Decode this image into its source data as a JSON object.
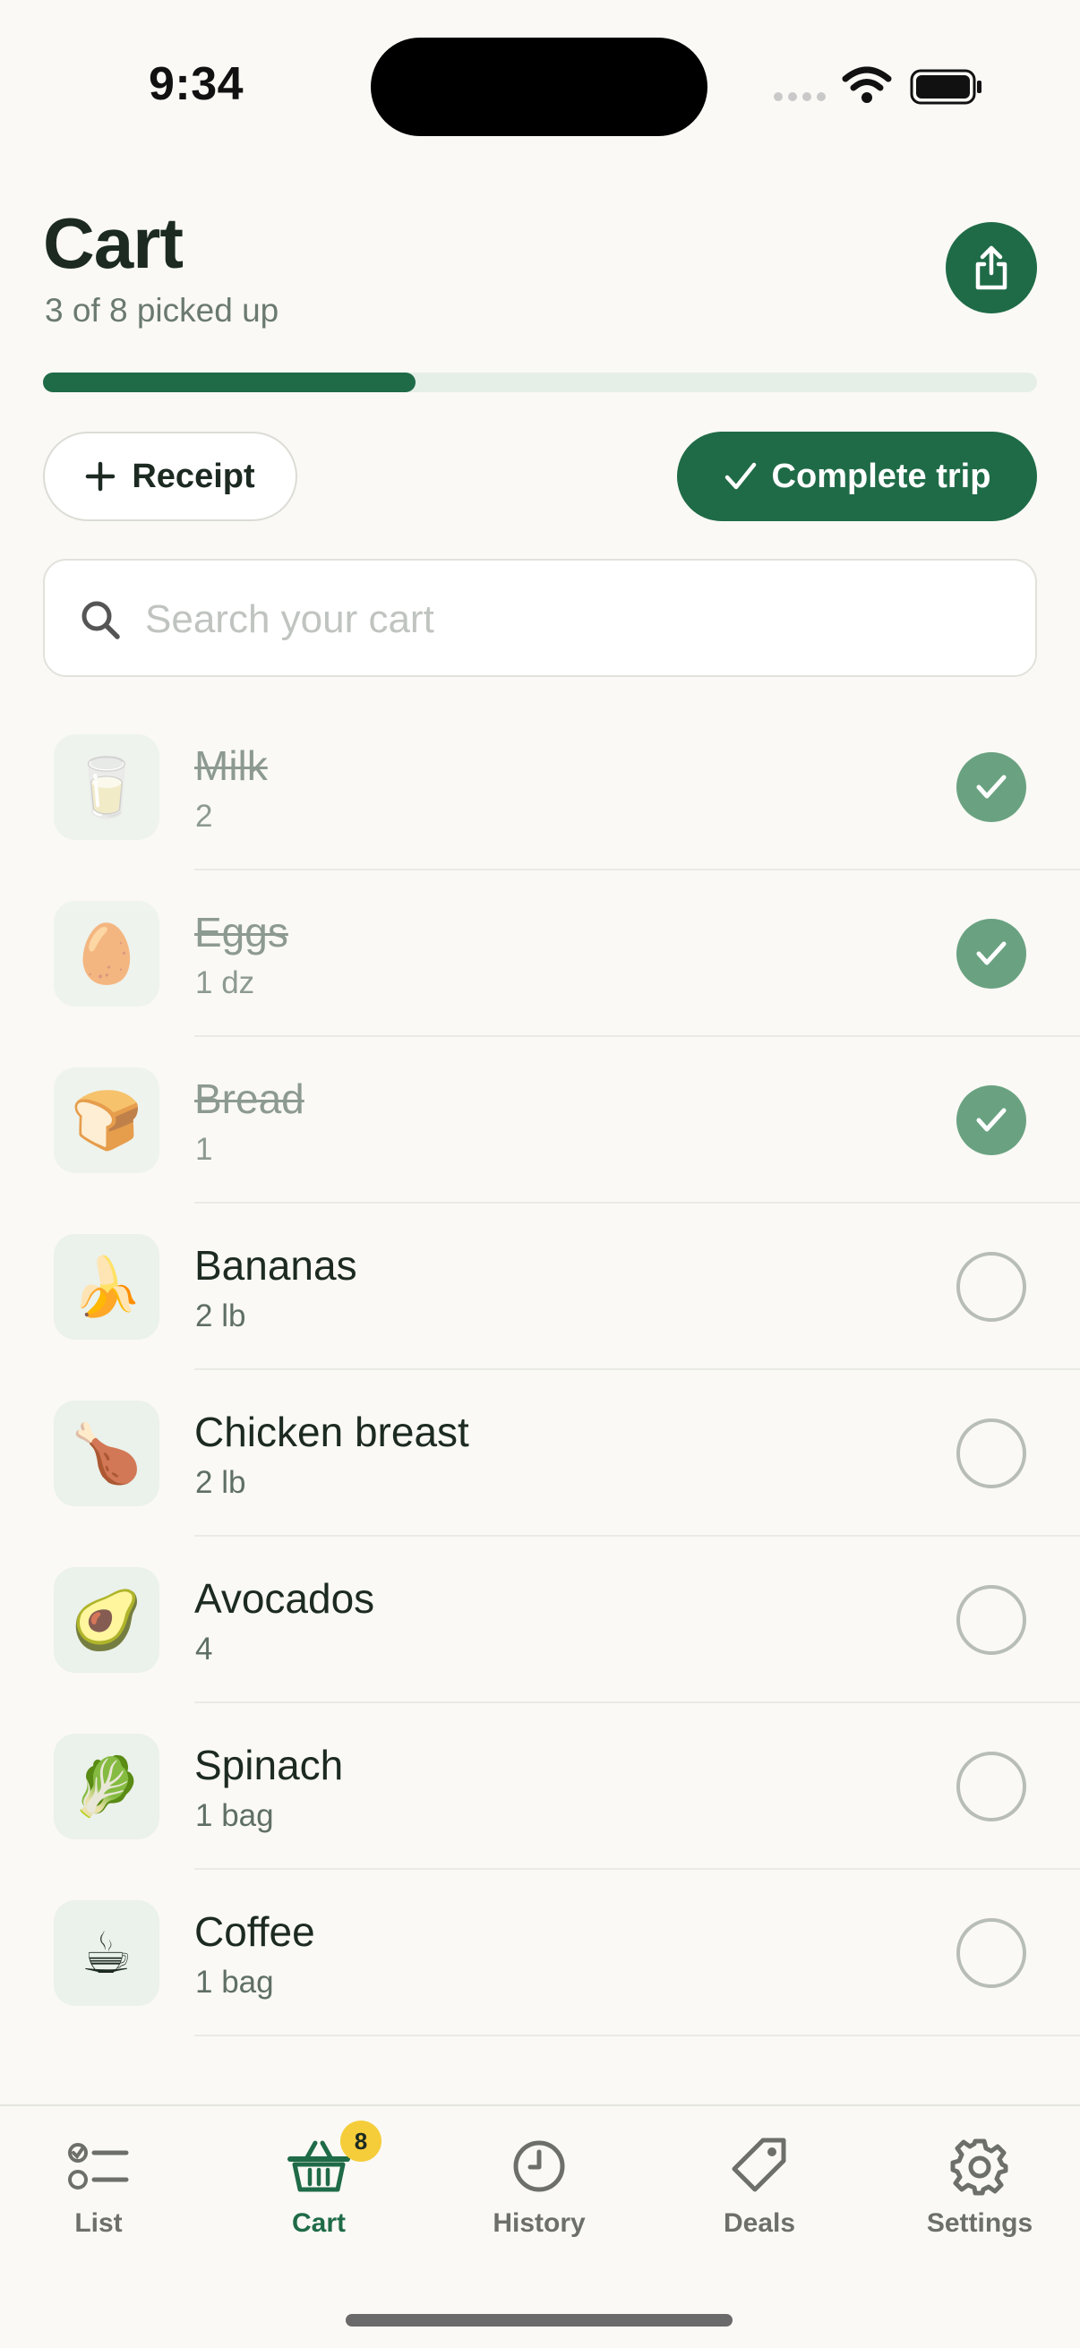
{
  "status": {
    "time": "9:34"
  },
  "header": {
    "title": "Cart",
    "subtitle": "3 of 8 picked up",
    "progress": 0.375
  },
  "actions": {
    "receipt_label": "Receipt",
    "complete_label": "Complete trip"
  },
  "search": {
    "placeholder": "Search your cart",
    "value": ""
  },
  "items": [
    {
      "emoji": "🥛",
      "name": "Milk",
      "qty": "2",
      "done": true
    },
    {
      "emoji": "🥚",
      "name": "Eggs",
      "qty": "1 dz",
      "done": true
    },
    {
      "emoji": "🍞",
      "name": "Bread",
      "qty": "1",
      "done": true
    },
    {
      "emoji": "🍌",
      "name": "Bananas",
      "qty": "2 lb",
      "done": false
    },
    {
      "emoji": "🍗",
      "name": "Chicken breast",
      "qty": "2 lb",
      "done": false
    },
    {
      "emoji": "🥑",
      "name": "Avocados",
      "qty": "4",
      "done": false
    },
    {
      "emoji": "🥬",
      "name": "Spinach",
      "qty": "1 bag",
      "done": false
    },
    {
      "emoji": "☕",
      "name": "Coffee",
      "qty": "1 bag",
      "done": false
    }
  ],
  "tabs": [
    {
      "label": "List",
      "icon": "checklist-icon",
      "active": false
    },
    {
      "label": "Cart",
      "icon": "basket-icon",
      "active": true,
      "badge": "8"
    },
    {
      "label": "History",
      "icon": "clock-icon",
      "active": false
    },
    {
      "label": "Deals",
      "icon": "tag-icon",
      "active": false
    },
    {
      "label": "Settings",
      "icon": "gear-icon",
      "active": false
    }
  ],
  "colors": {
    "accent": "#1f6b47",
    "checked": "#6aa281",
    "badge": "#f5cd3a"
  }
}
